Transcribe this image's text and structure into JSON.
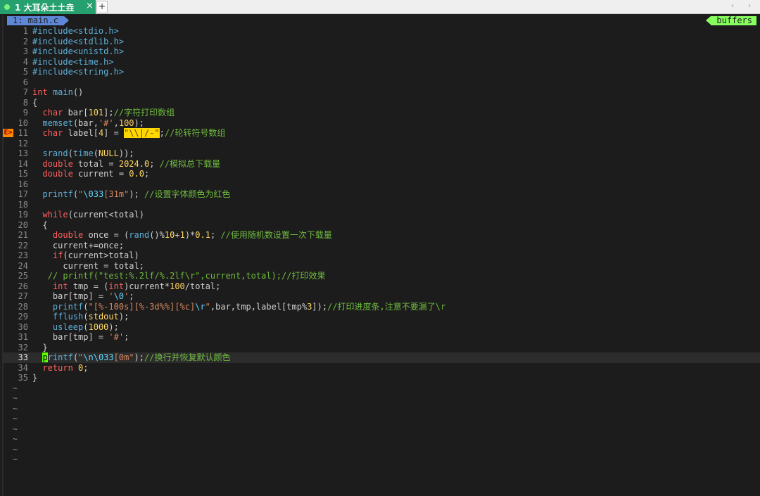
{
  "tabbar": {
    "tab_label": "1 大耳朵土土垚",
    "close_glyph": "×",
    "new_tab_glyph": "+",
    "nav_glyphs": "‹ ›"
  },
  "statusline": {
    "buffer_name": "1: main.c",
    "buffers_label": "buffers"
  },
  "colors": {
    "tab_active": "#25a06e",
    "buffer_name_bg": "#5f87d7",
    "buffers_bg": "#87ff5f",
    "sign_bg": "#ff8700",
    "cursor": "#5fff00",
    "search_highlight": "#ffd700"
  },
  "editor": {
    "current_line": 33,
    "sign": {
      "line": 11,
      "text": "E>"
    },
    "lines": [
      {
        "n": 1,
        "tokens": [
          [
            "pp",
            "#include<stdio.h>"
          ]
        ]
      },
      {
        "n": 2,
        "tokens": [
          [
            "pp",
            "#include<stdlib.h>"
          ]
        ]
      },
      {
        "n": 3,
        "tokens": [
          [
            "pp",
            "#include<unistd.h>"
          ]
        ]
      },
      {
        "n": 4,
        "tokens": [
          [
            "pp",
            "#include<time.h>"
          ]
        ]
      },
      {
        "n": 5,
        "tokens": [
          [
            "pp",
            "#include<string.h>"
          ]
        ]
      },
      {
        "n": 6,
        "tokens": []
      },
      {
        "n": 7,
        "tokens": [
          [
            "ty",
            "int"
          ],
          [
            "plain",
            " "
          ],
          [
            "fn",
            "main"
          ],
          [
            "plain",
            "()"
          ]
        ]
      },
      {
        "n": 8,
        "tokens": [
          [
            "plain",
            "{"
          ]
        ]
      },
      {
        "n": 9,
        "tokens": [
          [
            "plain",
            "  "
          ],
          [
            "ty",
            "char"
          ],
          [
            "plain",
            " bar["
          ],
          [
            "num-lit",
            "101"
          ],
          [
            "plain",
            "];"
          ],
          [
            "com",
            "//字符打印数组"
          ]
        ]
      },
      {
        "n": 10,
        "tokens": [
          [
            "plain",
            "  "
          ],
          [
            "fn",
            "memset"
          ],
          [
            "plain",
            "(bar,"
          ],
          [
            "str",
            "'#'"
          ],
          [
            "plain",
            ","
          ],
          [
            "num-lit",
            "100"
          ],
          [
            "plain",
            ");"
          ]
        ]
      },
      {
        "n": 11,
        "tokens": [
          [
            "plain",
            "  "
          ],
          [
            "ty",
            "char"
          ],
          [
            "plain",
            " label["
          ],
          [
            "num-lit",
            "4"
          ],
          [
            "plain",
            "] = "
          ],
          [
            "hl",
            "\"\\\\|/-\""
          ],
          [
            "plain",
            ";"
          ],
          [
            "com",
            "//轮转符号数组"
          ]
        ]
      },
      {
        "n": 12,
        "tokens": []
      },
      {
        "n": 13,
        "tokens": [
          [
            "plain",
            "  "
          ],
          [
            "fn",
            "srand"
          ],
          [
            "plain",
            "("
          ],
          [
            "fn",
            "time"
          ],
          [
            "plain",
            "("
          ],
          [
            "num-lit",
            "NULL"
          ],
          [
            "plain",
            "));"
          ]
        ]
      },
      {
        "n": 14,
        "tokens": [
          [
            "plain",
            "  "
          ],
          [
            "ty",
            "double"
          ],
          [
            "plain",
            " total = "
          ],
          [
            "num-lit",
            "2024.0"
          ],
          [
            "plain",
            "; "
          ],
          [
            "com",
            "//模拟总下载量"
          ]
        ]
      },
      {
        "n": 15,
        "tokens": [
          [
            "plain",
            "  "
          ],
          [
            "ty",
            "double"
          ],
          [
            "plain",
            " current = "
          ],
          [
            "num-lit",
            "0.0"
          ],
          [
            "plain",
            ";"
          ]
        ]
      },
      {
        "n": 16,
        "tokens": []
      },
      {
        "n": 17,
        "tokens": [
          [
            "plain",
            "  "
          ],
          [
            "fn",
            "printf"
          ],
          [
            "plain",
            "("
          ],
          [
            "str",
            "\""
          ],
          [
            "esc",
            "\\033"
          ],
          [
            "str",
            "[31m\""
          ],
          [
            "plain",
            "); "
          ],
          [
            "com",
            "//设置字体颜色为红色"
          ]
        ]
      },
      {
        "n": 18,
        "tokens": []
      },
      {
        "n": 19,
        "tokens": [
          [
            "plain",
            "  "
          ],
          [
            "ty",
            "while"
          ],
          [
            "plain",
            "(current<total)"
          ]
        ]
      },
      {
        "n": 20,
        "tokens": [
          [
            "plain",
            "  {"
          ]
        ]
      },
      {
        "n": 21,
        "tokens": [
          [
            "plain",
            "    "
          ],
          [
            "ty",
            "double"
          ],
          [
            "plain",
            " once = ("
          ],
          [
            "fn",
            "rand"
          ],
          [
            "plain",
            "()%"
          ],
          [
            "num-lit",
            "10"
          ],
          [
            "plain",
            "+"
          ],
          [
            "num-lit",
            "1"
          ],
          [
            "plain",
            ")*"
          ],
          [
            "num-lit",
            "0.1"
          ],
          [
            "plain",
            "; "
          ],
          [
            "com",
            "//使用随机数设置一次下载量"
          ]
        ]
      },
      {
        "n": 22,
        "tokens": [
          [
            "plain",
            "    current+=once;"
          ]
        ]
      },
      {
        "n": 23,
        "tokens": [
          [
            "plain",
            "    "
          ],
          [
            "ty",
            "if"
          ],
          [
            "plain",
            "(current>total)"
          ]
        ]
      },
      {
        "n": 24,
        "tokens": [
          [
            "plain",
            "      current = total;"
          ]
        ]
      },
      {
        "n": 25,
        "tokens": [
          [
            "plain",
            "   "
          ],
          [
            "com",
            "// printf(\"test:%.2lf/%.2lf\\r\",current,total);//打印效果"
          ]
        ]
      },
      {
        "n": 26,
        "tokens": [
          [
            "plain",
            "    "
          ],
          [
            "ty",
            "int"
          ],
          [
            "plain",
            " tmp = ("
          ],
          [
            "ty",
            "int"
          ],
          [
            "plain",
            ")current*"
          ],
          [
            "num-lit",
            "100"
          ],
          [
            "plain",
            "/total;"
          ]
        ]
      },
      {
        "n": 27,
        "tokens": [
          [
            "plain",
            "    bar[tmp] = "
          ],
          [
            "str",
            "'"
          ],
          [
            "esc",
            "\\0"
          ],
          [
            "str",
            "'"
          ],
          [
            "plain",
            ";"
          ]
        ]
      },
      {
        "n": 28,
        "tokens": [
          [
            "plain",
            "    "
          ],
          [
            "fn",
            "printf"
          ],
          [
            "plain",
            "("
          ],
          [
            "str",
            "\"[%-100s][%-3d%%][%c]"
          ],
          [
            "esc",
            "\\r"
          ],
          [
            "str",
            "\""
          ],
          [
            "plain",
            ",bar,tmp,label[tmp%"
          ],
          [
            "num-lit",
            "3"
          ],
          [
            "plain",
            "]);"
          ],
          [
            "com",
            "//打印进度条,注意不要漏了\\r"
          ]
        ]
      },
      {
        "n": 29,
        "tokens": [
          [
            "plain",
            "    "
          ],
          [
            "fn",
            "fflush"
          ],
          [
            "plain",
            "("
          ],
          [
            "num-lit",
            "stdout"
          ],
          [
            "plain",
            ");"
          ]
        ]
      },
      {
        "n": 30,
        "tokens": [
          [
            "plain",
            "    "
          ],
          [
            "fn",
            "usleep"
          ],
          [
            "plain",
            "("
          ],
          [
            "num-lit",
            "1000"
          ],
          [
            "plain",
            ");"
          ]
        ]
      },
      {
        "n": 31,
        "tokens": [
          [
            "plain",
            "    bar[tmp] = "
          ],
          [
            "str",
            "'#'"
          ],
          [
            "plain",
            ";"
          ]
        ]
      },
      {
        "n": 32,
        "tokens": [
          [
            "plain",
            "  }"
          ]
        ]
      },
      {
        "n": 33,
        "tokens": [
          [
            "plain",
            "  "
          ],
          [
            "cursor",
            "p"
          ],
          [
            "fn",
            "rintf"
          ],
          [
            "plain",
            "("
          ],
          [
            "str",
            "\""
          ],
          [
            "esc",
            "\\n\\033"
          ],
          [
            "str",
            "[0m\""
          ],
          [
            "plain",
            ");"
          ],
          [
            "com",
            "//换行并恢复默认颜色"
          ]
        ]
      },
      {
        "n": 34,
        "tokens": [
          [
            "plain",
            "  "
          ],
          [
            "ty",
            "return"
          ],
          [
            "plain",
            " "
          ],
          [
            "num-lit",
            "0"
          ],
          [
            "plain",
            ";"
          ]
        ]
      },
      {
        "n": 35,
        "tokens": [
          [
            "plain",
            "}"
          ]
        ]
      }
    ],
    "empty_marker": "~",
    "empty_line_count": 8
  }
}
